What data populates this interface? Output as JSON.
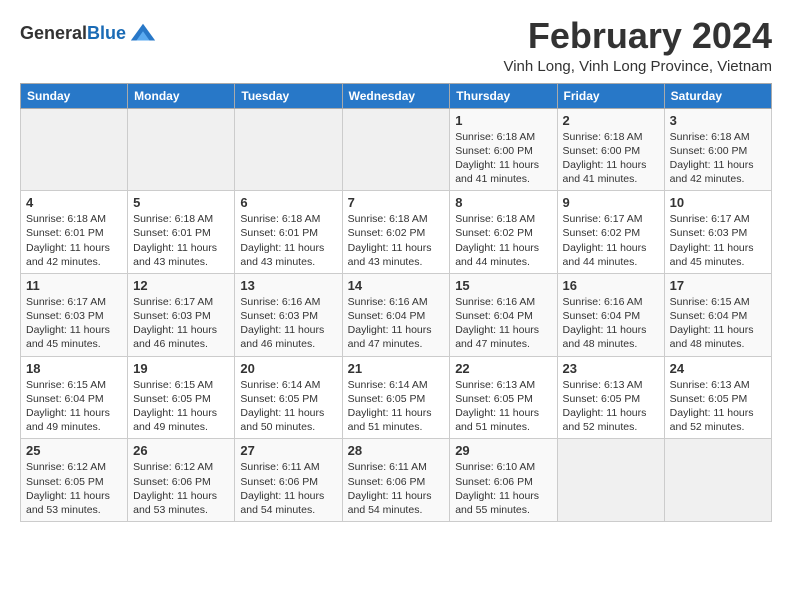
{
  "logo": {
    "general": "General",
    "blue": "Blue"
  },
  "title": "February 2024",
  "subtitle": "Vinh Long, Vinh Long Province, Vietnam",
  "days_of_week": [
    "Sunday",
    "Monday",
    "Tuesday",
    "Wednesday",
    "Thursday",
    "Friday",
    "Saturday"
  ],
  "weeks": [
    [
      {
        "day": "",
        "info": ""
      },
      {
        "day": "",
        "info": ""
      },
      {
        "day": "",
        "info": ""
      },
      {
        "day": "",
        "info": ""
      },
      {
        "day": "1",
        "info": "Sunrise: 6:18 AM\nSunset: 6:00 PM\nDaylight: 11 hours and 41 minutes."
      },
      {
        "day": "2",
        "info": "Sunrise: 6:18 AM\nSunset: 6:00 PM\nDaylight: 11 hours and 41 minutes."
      },
      {
        "day": "3",
        "info": "Sunrise: 6:18 AM\nSunset: 6:00 PM\nDaylight: 11 hours and 42 minutes."
      }
    ],
    [
      {
        "day": "4",
        "info": "Sunrise: 6:18 AM\nSunset: 6:01 PM\nDaylight: 11 hours and 42 minutes."
      },
      {
        "day": "5",
        "info": "Sunrise: 6:18 AM\nSunset: 6:01 PM\nDaylight: 11 hours and 43 minutes."
      },
      {
        "day": "6",
        "info": "Sunrise: 6:18 AM\nSunset: 6:01 PM\nDaylight: 11 hours and 43 minutes."
      },
      {
        "day": "7",
        "info": "Sunrise: 6:18 AM\nSunset: 6:02 PM\nDaylight: 11 hours and 43 minutes."
      },
      {
        "day": "8",
        "info": "Sunrise: 6:18 AM\nSunset: 6:02 PM\nDaylight: 11 hours and 44 minutes."
      },
      {
        "day": "9",
        "info": "Sunrise: 6:17 AM\nSunset: 6:02 PM\nDaylight: 11 hours and 44 minutes."
      },
      {
        "day": "10",
        "info": "Sunrise: 6:17 AM\nSunset: 6:03 PM\nDaylight: 11 hours and 45 minutes."
      }
    ],
    [
      {
        "day": "11",
        "info": "Sunrise: 6:17 AM\nSunset: 6:03 PM\nDaylight: 11 hours and 45 minutes."
      },
      {
        "day": "12",
        "info": "Sunrise: 6:17 AM\nSunset: 6:03 PM\nDaylight: 11 hours and 46 minutes."
      },
      {
        "day": "13",
        "info": "Sunrise: 6:16 AM\nSunset: 6:03 PM\nDaylight: 11 hours and 46 minutes."
      },
      {
        "day": "14",
        "info": "Sunrise: 6:16 AM\nSunset: 6:04 PM\nDaylight: 11 hours and 47 minutes."
      },
      {
        "day": "15",
        "info": "Sunrise: 6:16 AM\nSunset: 6:04 PM\nDaylight: 11 hours and 47 minutes."
      },
      {
        "day": "16",
        "info": "Sunrise: 6:16 AM\nSunset: 6:04 PM\nDaylight: 11 hours and 48 minutes."
      },
      {
        "day": "17",
        "info": "Sunrise: 6:15 AM\nSunset: 6:04 PM\nDaylight: 11 hours and 48 minutes."
      }
    ],
    [
      {
        "day": "18",
        "info": "Sunrise: 6:15 AM\nSunset: 6:04 PM\nDaylight: 11 hours and 49 minutes."
      },
      {
        "day": "19",
        "info": "Sunrise: 6:15 AM\nSunset: 6:05 PM\nDaylight: 11 hours and 49 minutes."
      },
      {
        "day": "20",
        "info": "Sunrise: 6:14 AM\nSunset: 6:05 PM\nDaylight: 11 hours and 50 minutes."
      },
      {
        "day": "21",
        "info": "Sunrise: 6:14 AM\nSunset: 6:05 PM\nDaylight: 11 hours and 51 minutes."
      },
      {
        "day": "22",
        "info": "Sunrise: 6:13 AM\nSunset: 6:05 PM\nDaylight: 11 hours and 51 minutes."
      },
      {
        "day": "23",
        "info": "Sunrise: 6:13 AM\nSunset: 6:05 PM\nDaylight: 11 hours and 52 minutes."
      },
      {
        "day": "24",
        "info": "Sunrise: 6:13 AM\nSunset: 6:05 PM\nDaylight: 11 hours and 52 minutes."
      }
    ],
    [
      {
        "day": "25",
        "info": "Sunrise: 6:12 AM\nSunset: 6:05 PM\nDaylight: 11 hours and 53 minutes."
      },
      {
        "day": "26",
        "info": "Sunrise: 6:12 AM\nSunset: 6:06 PM\nDaylight: 11 hours and 53 minutes."
      },
      {
        "day": "27",
        "info": "Sunrise: 6:11 AM\nSunset: 6:06 PM\nDaylight: 11 hours and 54 minutes."
      },
      {
        "day": "28",
        "info": "Sunrise: 6:11 AM\nSunset: 6:06 PM\nDaylight: 11 hours and 54 minutes."
      },
      {
        "day": "29",
        "info": "Sunrise: 6:10 AM\nSunset: 6:06 PM\nDaylight: 11 hours and 55 minutes."
      },
      {
        "day": "",
        "info": ""
      },
      {
        "day": "",
        "info": ""
      }
    ]
  ]
}
